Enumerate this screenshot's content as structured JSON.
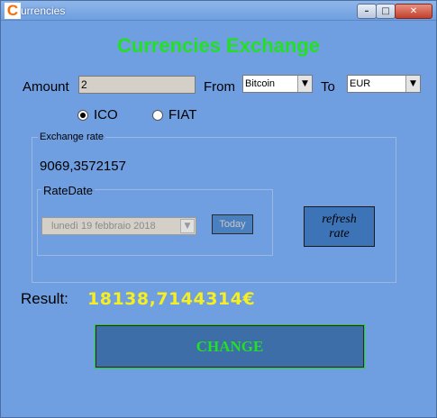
{
  "window": {
    "icon_letter": "C",
    "title": "urrencies",
    "controls": {
      "minimize": "–",
      "maximize": "□",
      "close": "✕"
    }
  },
  "heading": "Currencies Exchange",
  "amount": {
    "label": "Amount",
    "value": "2"
  },
  "from": {
    "label": "From",
    "selected": "Bitcoin"
  },
  "to": {
    "label": "To",
    "selected": "EUR"
  },
  "type_radios": [
    {
      "label": "ICO",
      "checked": true
    },
    {
      "label": "FIAT",
      "checked": false
    }
  ],
  "exchange_rate": {
    "group_label": "Exchange rate",
    "value": "9069,3572157",
    "rate_date": {
      "group_label": "RateDate",
      "date": "lunedì   19  febbraio  2018",
      "today_label": "Today"
    },
    "refresh_label_line1": "refresh",
    "refresh_label_line2": "rate"
  },
  "result": {
    "label": "Result:",
    "value": "18138,7144314€"
  },
  "change_label": "CHANGE",
  "colors": {
    "background": "#6f9fe0",
    "heading": "#22e022",
    "result_value": "#f5ee20",
    "button": "#3e6ea8"
  }
}
